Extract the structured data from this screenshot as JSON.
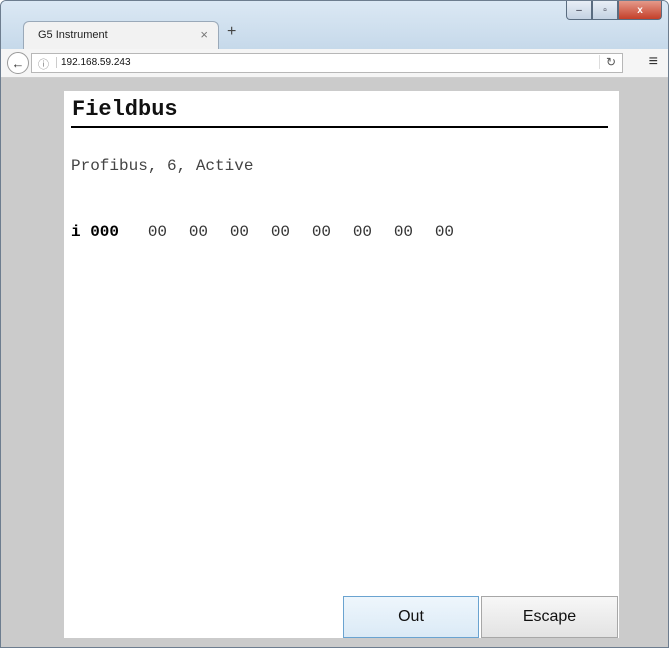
{
  "browser": {
    "tab_title": "G5 Instrument",
    "tab_close": "×",
    "new_tab": "+",
    "url": "192.168.59.243",
    "window_buttons": {
      "minimize": "–",
      "maximize": "▫",
      "close": "x"
    }
  },
  "page": {
    "title": "Fieldbus",
    "status": "Profibus, 6, Active",
    "data_row": {
      "label": "i 000",
      "bytes": [
        "00",
        "00",
        "00",
        "00",
        "00",
        "00",
        "00",
        "00"
      ]
    },
    "buttons": {
      "out": "Out",
      "escape": "Escape"
    }
  }
}
